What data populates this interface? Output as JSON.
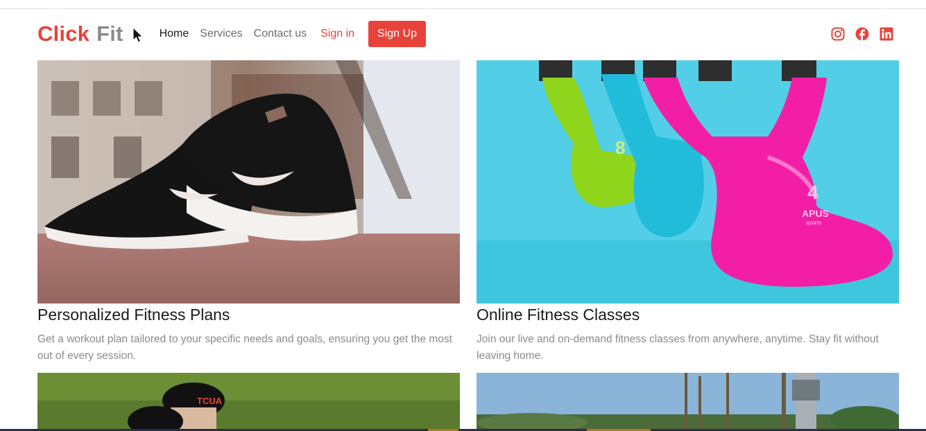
{
  "brand": {
    "word1": "Click",
    "word2": "Fit"
  },
  "nav": {
    "links": [
      {
        "label": "Home"
      },
      {
        "label": "Services"
      },
      {
        "label": "Contact us"
      }
    ],
    "signin_label": "Sign in",
    "signup_label": "Sign Up"
  },
  "socials": [
    "instagram-icon",
    "facebook-icon",
    "linkedin-icon"
  ],
  "colors": {
    "accent": "#e8433a",
    "muted": "#8a8a8a"
  },
  "cards": [
    {
      "title": "Personalized Fitness Plans",
      "description": "Get a workout plan tailored to your specific needs and goals, ensuring you get the most out of every session."
    },
    {
      "title": "Online Fitness Classes",
      "description": "Join our live and on-demand fitness classes from anywhere, anytime. Stay fit without leaving home."
    }
  ],
  "image_text": {
    "kettlebell_green": "8",
    "kettlebell_pink": "4",
    "kettlebell_brand": "APUS",
    "kettlebell_brand_sub": "sports",
    "cap_text": "TCUA"
  }
}
